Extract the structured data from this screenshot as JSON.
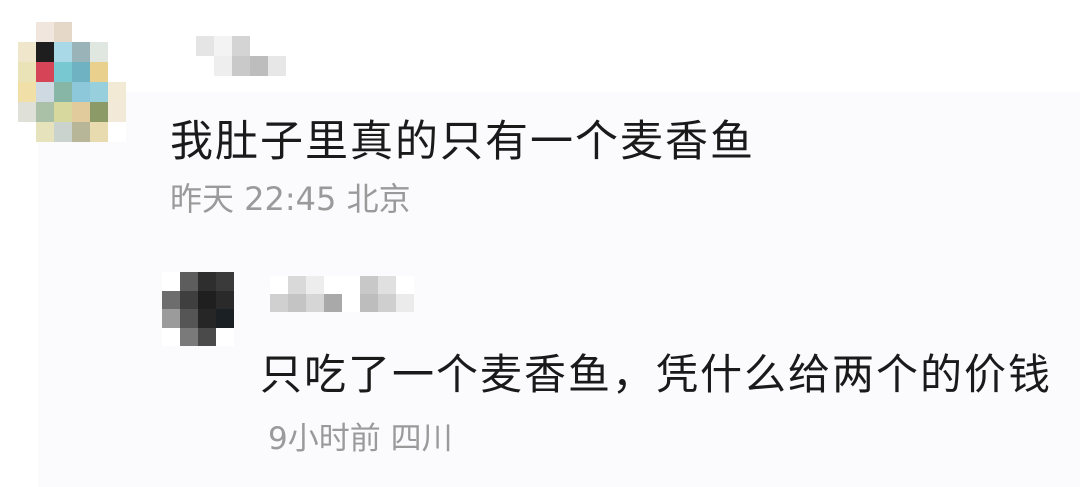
{
  "comment": {
    "text": "我肚子里真的只有一个麦香鱼",
    "time": "昨天 22:45",
    "location": "北京"
  },
  "reply": {
    "text": "只吃了一个麦香鱼，凭什么给两个的价钱",
    "time": "9小时前",
    "location": "四川"
  },
  "avatar1_pixels": [
    "#ffffff",
    "#f1e6de",
    "#e6d8c8",
    "#ffffff",
    "#ffffff",
    "#ffffff",
    "#f0e6cc",
    "#1e1e1e",
    "#a9d8e6",
    "#9ab3b9",
    "#e0e6e0",
    "#ffffff",
    "#e9e3b7",
    "#d64557",
    "#77c8d0",
    "#6fb2c2",
    "#e9d08d",
    "#ffffff",
    "#f0e0a8",
    "#cfd9e1",
    "#87b5a6",
    "#8dc8da",
    "#97d0dc",
    "#f2ead5",
    "#dfe0d7",
    "#aac1a8",
    "#d6d89e",
    "#e1ca9b",
    "#8c9a67",
    "#f2e9d9",
    "#ffffff",
    "#e6e2bc",
    "#cbd3cf",
    "#b7b698",
    "#e7dbaf",
    "#ffffff"
  ],
  "name1_pixels": [
    "#e5e5e5",
    "#f3f3f3",
    "#d4d4d4",
    "#ffffff",
    "#ffffff",
    "#ffffff",
    "#eeeeee",
    "#c9c9c9",
    "#bdbdbd",
    "#e7e7e7"
  ],
  "avatar2_pixels": [
    "#ffffff",
    "#5d5d5d",
    "#2e2e2e",
    "#3a3a3a",
    "#6d6d6d",
    "#3f3f3f",
    "#1f1f1f",
    "#2a2a2a",
    "#9b9b9b",
    "#555555",
    "#262626",
    "#1b2024",
    "#ffffff",
    "#7a7a7a",
    "#4a4a4a",
    "#ffffff"
  ],
  "name2_pixels": [
    "#ffffff",
    "#d9d9d9",
    "#ededed",
    "#ffffff",
    "#ffffff",
    "#c8c8c8",
    "#e0e0e0",
    "#ffffff",
    "#d0d0d0",
    "#c4c4c4",
    "#d6d6d6",
    "#a9a9a9",
    "#ffffff",
    "#bdbdbd",
    "#cfcfcf",
    "#ebebeb"
  ]
}
